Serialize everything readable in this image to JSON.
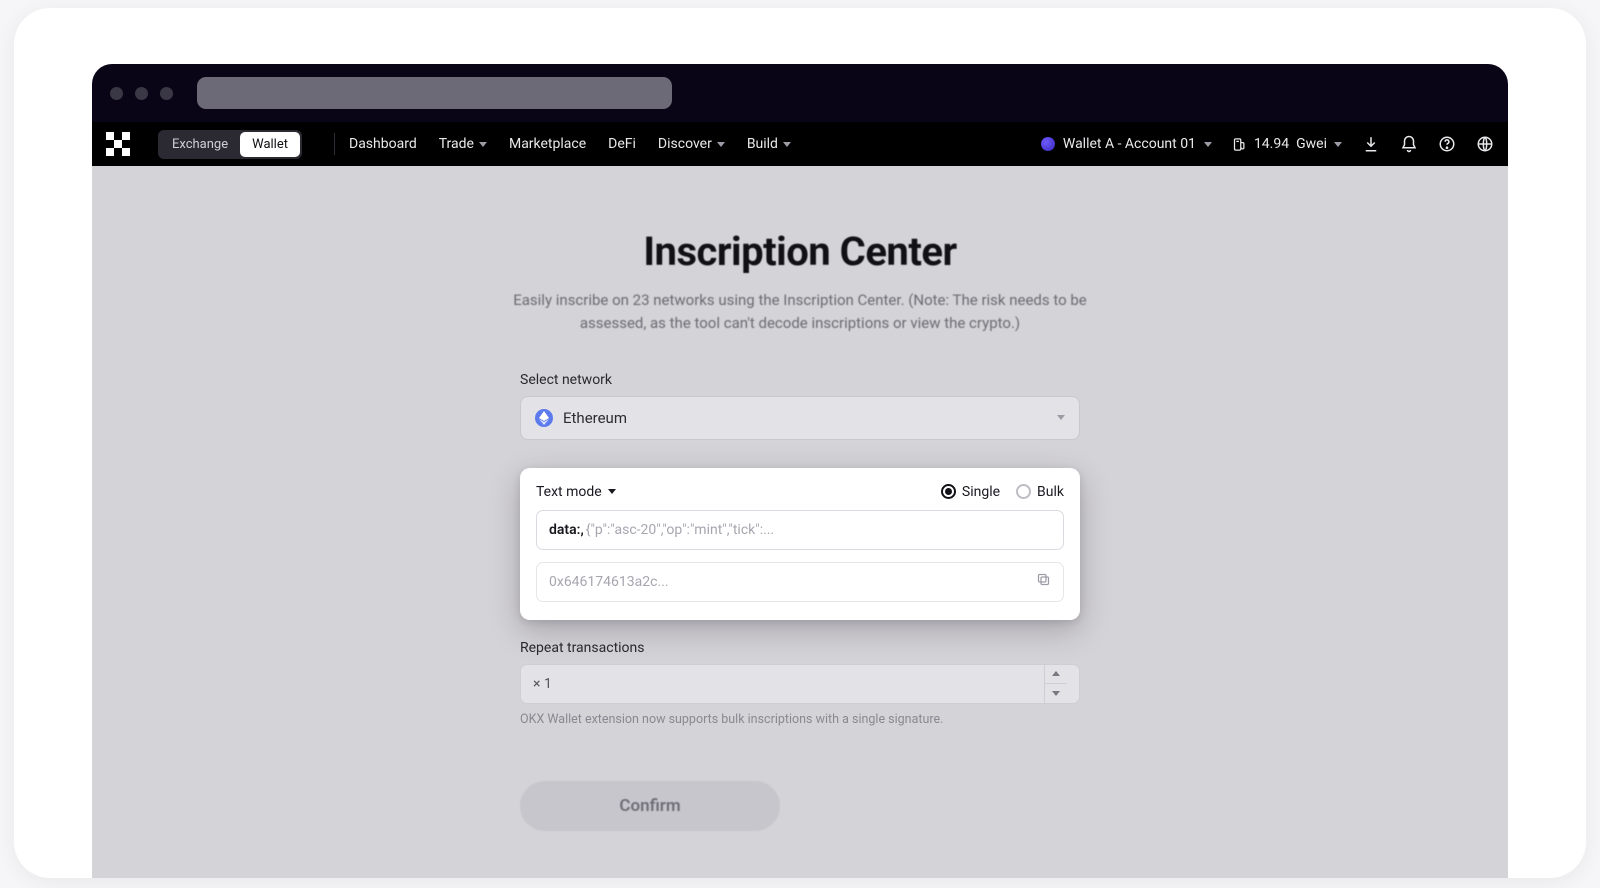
{
  "nav": {
    "toggle": {
      "exchange": "Exchange",
      "wallet": "Wallet",
      "active": "wallet"
    },
    "items": [
      {
        "label": "Dashboard",
        "caret": false
      },
      {
        "label": "Trade",
        "caret": true
      },
      {
        "label": "Marketplace",
        "caret": false
      },
      {
        "label": "DeFi",
        "caret": false
      },
      {
        "label": "Discover",
        "caret": true
      },
      {
        "label": "Build",
        "caret": true
      }
    ],
    "account_label": "Wallet A - Account 01",
    "gas": {
      "value": "14.94",
      "unit": "Gwei"
    }
  },
  "page": {
    "title": "Inscription Center",
    "subtitle": "Easily inscribe on 23 networks using the Inscription Center. (Note: The risk needs to be assessed, as the tool can't decode inscriptions or view the crypto.)"
  },
  "select_network": {
    "label": "Select network",
    "value": "Ethereum"
  },
  "card": {
    "mode_label": "Text mode",
    "radio_single": "Single",
    "radio_bulk": "Bulk",
    "radio_selected": "single",
    "data_prefix": "data:,",
    "data_placeholder": "{\"p\":\"asc-20\",\"op\":\"mint\",\"tick\":...",
    "hex_placeholder": "0x646174613a2c..."
  },
  "repeat": {
    "label": "Repeat transactions",
    "prefix": "×",
    "value": "1",
    "hint": "OKX Wallet extension now supports bulk inscriptions with a single signature."
  },
  "confirm_label": "Confirm"
}
